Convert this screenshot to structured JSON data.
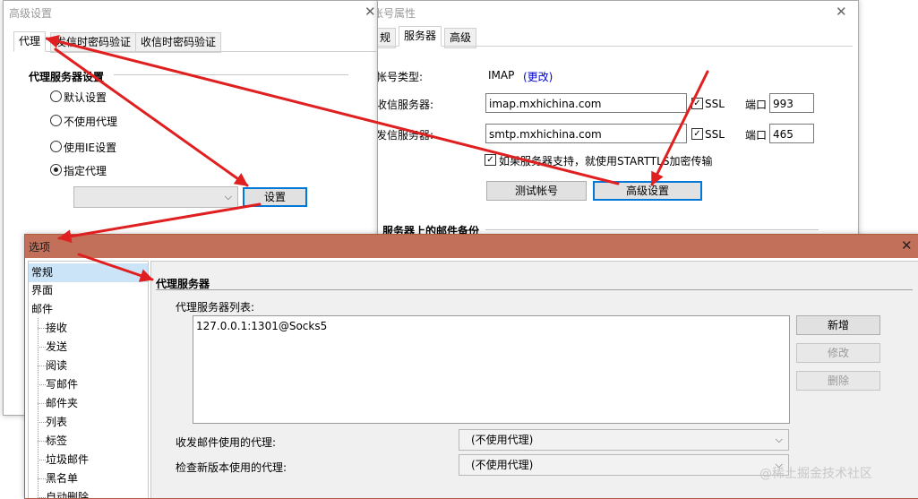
{
  "advanced_window": {
    "title": "高级设置",
    "tabs": [
      "代理",
      "发信时密码验证",
      "收信时密码验证"
    ],
    "section_title": "代理服务器设置",
    "options": [
      "默认设置",
      "不使用代理",
      "使用IE设置",
      "指定代理"
    ],
    "selected_option": 3,
    "proxy_select_value": "",
    "settings_button": "设置"
  },
  "account_window": {
    "title": "帐号属性",
    "tabs": [
      "规",
      "服务器",
      "高级"
    ],
    "account_type_label": "帐号类型:",
    "account_type_value": "IMAP",
    "change_link": "(更改)",
    "incoming_label": "收信服务器:",
    "incoming_server": "imap.mxhichina.com",
    "outgoing_label": "发信服务器:",
    "outgoing_server": "smtp.mxhichina.com",
    "ssl_label": "SSL",
    "port_label": "端口",
    "incoming_port": "993",
    "outgoing_port": "465",
    "starttls_label": "如果服务器支持，就使用STARTTLS加密传输",
    "test_button": "测试帐号",
    "advanced_button": "高级设置",
    "backup_label": "服务器上的邮件备份"
  },
  "options_window": {
    "title": "选项",
    "nav": [
      "常规",
      "界面",
      "邮件",
      "接收",
      "发送",
      "阅读",
      "写邮件",
      "邮件夹",
      "列表",
      "标签",
      "垃圾邮件",
      "黑名单",
      "自动删除"
    ],
    "section_title": "代理服务器",
    "list_label": "代理服务器列表:",
    "proxy_entries": [
      "127.0.0.1:1301@Socks5"
    ],
    "add_button": "新增",
    "edit_button": "修改",
    "delete_button": "删除",
    "mail_proxy_label": "收发邮件使用的代理:",
    "mail_proxy_value": "(不使用代理)",
    "update_proxy_label": "检查新版本使用的代理:",
    "update_proxy_value": "(不使用代理)"
  },
  "watermark": "@稀土掘金技术社区",
  "colors": {
    "options_titlebar": "#c2705a",
    "nav_selected": "#cce4f7",
    "annotation_arrow": "#e02020",
    "focus_border": "#0078d7",
    "link": "#0000cc"
  }
}
